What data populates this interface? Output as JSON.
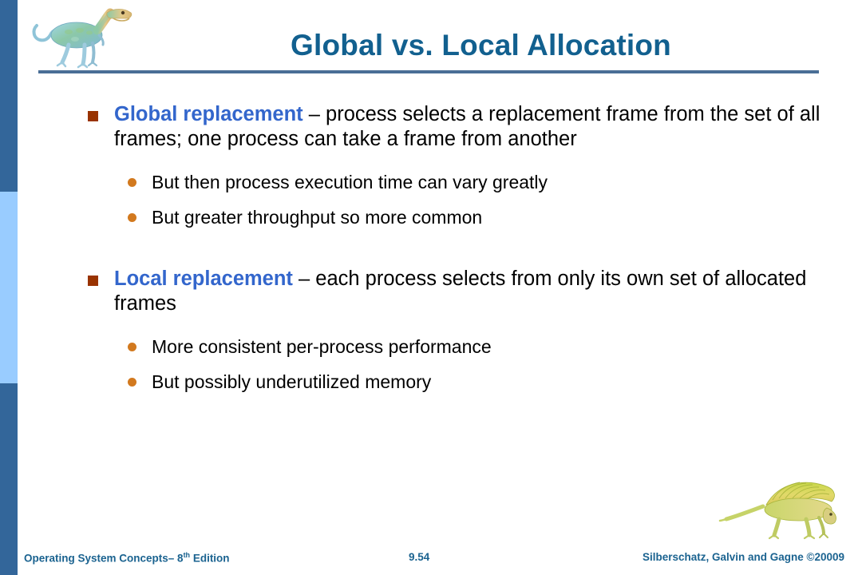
{
  "slide": {
    "title": "Global vs. Local Allocation",
    "content": [
      {
        "level": 1,
        "marker": "square-bullet",
        "lead": "Global replacement",
        "rest": " – process selects a replacement frame from the set of all frames; one process can take a frame from another"
      },
      {
        "level": 2,
        "marker": "round-bullet",
        "text": "But then process execution time can vary greatly"
      },
      {
        "level": 2,
        "marker": "round-bullet",
        "text": "But greater throughput so more common"
      },
      {
        "level": 1,
        "marker": "square-bullet",
        "lead": "Local replacement",
        "rest": " – each process selects from only its own set of allocated frames"
      },
      {
        "level": 2,
        "marker": "round-bullet",
        "text": "More consistent per-process performance"
      },
      {
        "level": 2,
        "marker": "round-bullet",
        "text": "But possibly underutilized memory"
      }
    ]
  },
  "footer": {
    "book": "Operating System Concepts– 8",
    "edition_ordinal": "th",
    "edition_word": " Edition",
    "page_number": "9.54",
    "credit": "Silberschatz, Galvin and Gagne ©20009"
  },
  "decor": {
    "header_dino": "theropod-dinosaur-image",
    "footer_dino": "dimetrodon-dinosaur-image",
    "sidebar_segments": [
      "dark-blue",
      "light-blue",
      "dark-blue"
    ]
  },
  "colors": {
    "title_blue": "#12608F",
    "lead_blue": "#3366CC",
    "square_bullet": "#993300",
    "round_bullet": "#D2791E",
    "rule_blue": "#4A6E96",
    "sidebar_dark": "#33669A",
    "sidebar_light": "#99CCFF",
    "footer_blue": "#1B6390"
  }
}
